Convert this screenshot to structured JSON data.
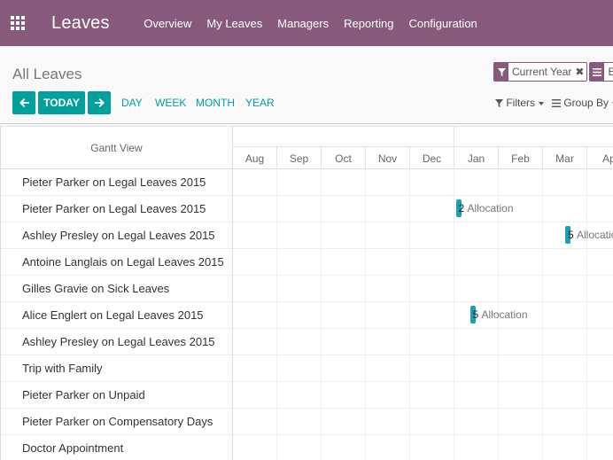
{
  "navbar": {
    "app_name": "Leaves",
    "menu": [
      "Overview",
      "My Leaves",
      "Managers",
      "Reporting",
      "Configuration"
    ]
  },
  "control": {
    "breadcrumb": "All Leaves",
    "facets": [
      {
        "label": "Current Year",
        "icon": "filter-icon"
      },
      {
        "label": "Em",
        "icon": "group-by-icon"
      }
    ],
    "today_label": "TODAY",
    "scales": [
      "DAY",
      "WEEK",
      "MONTH",
      "YEAR"
    ],
    "filters_label": "Filters",
    "groupby_label": "Group By"
  },
  "gantt": {
    "header": "Gantt View",
    "months": [
      "Aug",
      "Sep",
      "Oct",
      "Nov",
      "Dec",
      "Jan",
      "Feb",
      "Mar",
      "Ap"
    ],
    "rows": [
      {
        "label": "Pieter Parker on Legal Leaves 2015"
      },
      {
        "label": "Pieter Parker on Legal Leaves 2015",
        "bar": {
          "count": "2",
          "text": "Allocation",
          "month_offset": 5.03
        }
      },
      {
        "label": "Ashley Presley on Legal Leaves 2015",
        "bar": {
          "count": "5",
          "text": "Allocatio",
          "month_offset": 7.5
        }
      },
      {
        "label": "Antoine Langlais on Legal Leaves 2015"
      },
      {
        "label": "Gilles Gravie on Sick Leaves"
      },
      {
        "label": "Alice Englert on Legal Leaves 2015",
        "bar": {
          "count": "5",
          "text": "Allocation",
          "month_offset": 5.35
        }
      },
      {
        "label": "Ashley Presley on Legal Leaves 2015"
      },
      {
        "label": "Trip with Family"
      },
      {
        "label": "Pieter Parker on Unpaid"
      },
      {
        "label": "Pieter Parker on Compensatory Days"
      },
      {
        "label": "Doctor Appointment"
      }
    ]
  },
  "colors": {
    "brand": "#875a7b",
    "primary": "#00a09d",
    "bar": "#17a2b8"
  }
}
